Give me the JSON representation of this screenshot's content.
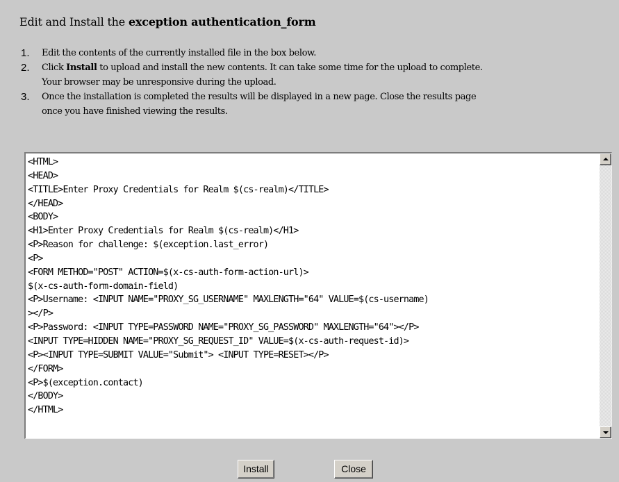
{
  "heading": {
    "prefix": "Edit and Install the ",
    "form_name": "exception authentication_form"
  },
  "steps": [
    {
      "number": "1.",
      "lines": [
        "Edit the contents of the currently installed file in the box below."
      ]
    },
    {
      "number": "2.",
      "prefix": "Click ",
      "bold": "Install",
      "rest": " to upload and install the new contents. It can take some time for the upload to complete.",
      "line2": "Your browser may be unresponsive during the upload."
    },
    {
      "number": "3.",
      "lines": [
        "Once the installation is completed the results will be displayed in a new page. Close the results page",
        "once you have finished viewing the results."
      ]
    }
  ],
  "editor": {
    "content": "<HTML>\n<HEAD>\n<TITLE>Enter Proxy Credentials for Realm $(cs-realm)</TITLE>\n</HEAD>\n<BODY>\n<H1>Enter Proxy Credentials for Realm $(cs-realm)</H1>\n<P>Reason for challenge: $(exception.last_error)\n<P>\n<FORM METHOD=\"POST\" ACTION=$(x-cs-auth-form-action-url)>\n$(x-cs-auth-form-domain-field)\n<P>Username: <INPUT NAME=\"PROXY_SG_USERNAME\" MAXLENGTH=\"64\" VALUE=$(cs-username)\n></P>\n<P>Password: <INPUT TYPE=PASSWORD NAME=\"PROXY_SG_PASSWORD\" MAXLENGTH=\"64\"></P>\n<INPUT TYPE=HIDDEN NAME=\"PROXY_SG_REQUEST_ID\" VALUE=$(x-cs-auth-request-id)>\n<P><INPUT TYPE=SUBMIT VALUE=\"Submit\"> <INPUT TYPE=RESET></P>\n</FORM>\n<P>$(exception.contact)\n</BODY>\n</HTML>"
  },
  "buttons": {
    "install": "Install",
    "close": "Close"
  },
  "icons": {
    "scroll_up": "triangle-up-icon",
    "scroll_down": "triangle-down-icon"
  }
}
